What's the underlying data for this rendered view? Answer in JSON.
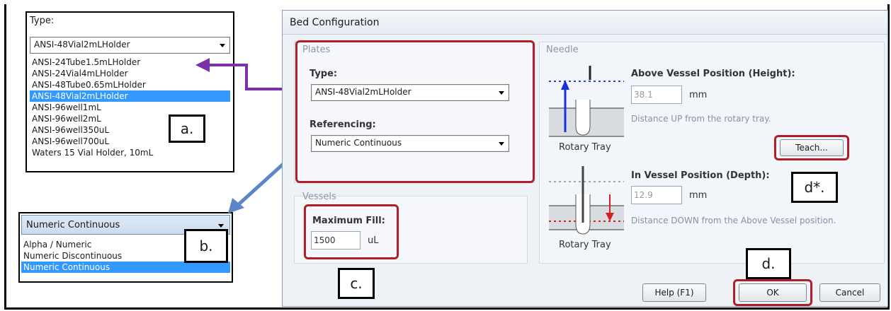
{
  "left_type_panel": {
    "label": "Type:",
    "selected": "ANSI-48Vial2mLHolder",
    "options": [
      "ANSI-24Tube1.5mLHolder",
      "ANSI-24Vial4mLHolder",
      "ANSI-48Tube0.65mLHolder",
      "ANSI-48Vial2mLHolder",
      "ANSI-96well1mL",
      "ANSI-96well2mL",
      "ANSI-96well350uL",
      "ANSI-96well700uL",
      "Waters 15 Vial Holder, 10mL"
    ],
    "highlighted": "ANSI-48Vial2mLHolder"
  },
  "left_ref_panel": {
    "selected": "Numeric Continuous",
    "options": [
      "Alpha / Numeric",
      "Numeric Discontinuous",
      "Numeric Continuous"
    ],
    "highlighted": "Numeric Continuous"
  },
  "labels": {
    "a": "a.",
    "b": "b.",
    "c": "c.",
    "d": "d.",
    "d_star": "d*."
  },
  "dialog": {
    "title": "Bed Configuration",
    "plates": {
      "group_title": "Plates",
      "type_label": "Type:",
      "type_value": "ANSI-48Vial2mLHolder",
      "ref_label": "Referencing:",
      "ref_value": "Numeric Continuous"
    },
    "vessels": {
      "group_title": "Vessels",
      "max_fill_label": "Maximum Fill:",
      "max_fill_value": "1500",
      "max_fill_unit": "uL"
    },
    "needle": {
      "group_title": "Needle",
      "above_label": "Above Vessel Position (Height):",
      "above_value": "38.1",
      "above_unit": "mm",
      "above_desc": "Distance UP from the rotary tray.",
      "teach_label": "Teach...",
      "in_label": "In Vessel Position (Depth):",
      "in_value": "12.9",
      "in_unit": "mm",
      "in_desc": "Distance DOWN from the Above Vessel position.",
      "tray_caption_1": "Rotary Tray",
      "tray_caption_2": "Rotary Tray"
    },
    "buttons": {
      "help": "Help (F1)",
      "ok": "OK",
      "cancel": "Cancel"
    }
  },
  "colors": {
    "red_highlight": "#b01e2a",
    "purple_arrow": "#7b2fa8",
    "blue_arrow": "#5b86c8",
    "selection": "#3399ff"
  }
}
